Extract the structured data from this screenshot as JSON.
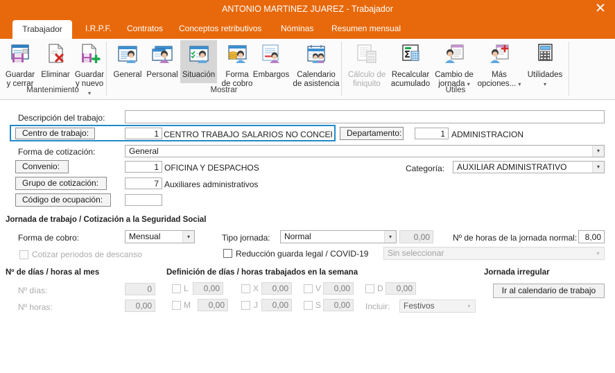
{
  "window": {
    "title": "ANTONIO MARTINEZ JUAREZ - Trabajador",
    "close_label": "✕",
    "accent_color": "#E8690B",
    "focus_color": "#2189C9"
  },
  "tabs": [
    {
      "label": "Trabajador",
      "active": true
    },
    {
      "label": "I.R.P.F.",
      "active": false
    },
    {
      "label": "Contratos",
      "active": false
    },
    {
      "label": "Conceptos retributivos",
      "active": false
    },
    {
      "label": "Nóminas",
      "active": false
    },
    {
      "label": "Resumen mensual",
      "active": false
    }
  ],
  "ribbon": {
    "groups": [
      {
        "label": "Mantenimiento"
      },
      {
        "label": "Mostrar"
      },
      {
        "label": "Útiles"
      }
    ],
    "buttons": [
      {
        "line1": "Guardar",
        "line2": "y cerrar",
        "icon": "save-close-icon",
        "state": "normal",
        "caret": false
      },
      {
        "line1": "Eliminar",
        "line2": "",
        "icon": "delete-icon",
        "state": "normal",
        "caret": false
      },
      {
        "line1": "Guardar",
        "line2": "y nuevo",
        "icon": "save-new-icon",
        "state": "normal",
        "caret": true
      },
      {
        "line1": "General",
        "line2": "",
        "icon": "general-icon",
        "state": "normal",
        "caret": false
      },
      {
        "line1": "Personal",
        "line2": "",
        "icon": "personal-icon",
        "state": "normal",
        "caret": false
      },
      {
        "line1": "Situación",
        "line2": "",
        "icon": "situacion-icon",
        "state": "selected",
        "caret": false
      },
      {
        "line1": "Forma",
        "line2": "de cobro",
        "icon": "forma-cobro-icon",
        "state": "normal",
        "caret": false
      },
      {
        "line1": "Embargos",
        "line2": "",
        "icon": "embargos-icon",
        "state": "normal",
        "caret": false
      },
      {
        "line1": "Calendario",
        "line2": "de asistencia",
        "icon": "calendario-asistencia-icon",
        "state": "normal",
        "caret": false
      },
      {
        "line1": "Cálculo de",
        "line2": "finiquito",
        "icon": "calculo-finiquito-icon",
        "state": "disabled",
        "caret": false
      },
      {
        "line1": "Recalcular",
        "line2": "acumulado",
        "icon": "recalcular-acumulado-icon",
        "state": "normal",
        "caret": false
      },
      {
        "line1": "Cambio de",
        "line2": "jornada",
        "icon": "cambio-jornada-icon",
        "state": "normal",
        "caret": true
      },
      {
        "line1": "Más",
        "line2": "opciones...",
        "icon": "mas-opciones-icon",
        "state": "normal",
        "caret": true
      },
      {
        "line1": "Utilidades",
        "line2": "",
        "icon": "utilidades-icon",
        "state": "normal",
        "caret": true
      }
    ]
  },
  "form": {
    "descripcion_trabajo": {
      "label": "Descripción del trabajo:",
      "value": ""
    },
    "centro_trabajo": {
      "label": "Centro de trabajo:",
      "code": "1",
      "name": "CENTRO TRABAJO SALARIOS NO CONCERTADO",
      "focused": true
    },
    "departamento": {
      "label": "Departamento:",
      "code": "1",
      "name": "ADMINISTRACION"
    },
    "forma_cotizacion": {
      "label": "Forma de cotización:",
      "value": "General"
    },
    "convenio": {
      "label": "Convenio:",
      "code": "1",
      "name": "OFICINA Y DESPACHOS"
    },
    "categoria": {
      "label": "Categoría:",
      "value": "AUXILIAR ADMINISTRATIVO"
    },
    "grupo_cotizacion": {
      "label": "Grupo de cotización:",
      "code": "7",
      "name": "Auxiliares administrativos"
    },
    "codigo_ocupacion": {
      "label": "Código de ocupación:",
      "code": ""
    }
  },
  "jornada": {
    "section_title": "Jornada de trabajo / Cotización a la Seguridad Social",
    "forma_cobro": {
      "label": "Forma de cobro:",
      "value": "Mensual"
    },
    "cotizar_descanso": {
      "label": "Cotizar periodos de descanso",
      "checked": false,
      "disabled": true
    },
    "tipo_jornada": {
      "label": "Tipo jornada:",
      "value": "Normal",
      "pct": "0,00"
    },
    "horas_normal": {
      "label": "Nº de horas de la jornada normal:",
      "value": "8,00"
    },
    "reduccion": {
      "label": "Reducción guarda legal / COVID-19",
      "checked": false,
      "select_value": "Sin seleccionar"
    }
  },
  "mes": {
    "title": "Nº de días / horas al mes",
    "dias": {
      "label": "Nº días:",
      "value": "0"
    },
    "horas": {
      "label": "Nº horas:",
      "value": "0,00"
    }
  },
  "semana": {
    "title": "Definición de días / horas trabajados en la semana",
    "days": [
      {
        "key": "L",
        "value": "0,00",
        "checked": false
      },
      {
        "key": "M",
        "value": "0,00",
        "checked": false
      },
      {
        "key": "X",
        "value": "0,00",
        "checked": false
      },
      {
        "key": "J",
        "value": "0,00",
        "checked": false
      },
      {
        "key": "V",
        "value": "0,00",
        "checked": false
      },
      {
        "key": "S",
        "value": "0,00",
        "checked": false
      },
      {
        "key": "D",
        "value": "0,00",
        "checked": false
      }
    ],
    "incluir": {
      "label": "Incluir:",
      "value": "Festivos"
    }
  },
  "irregular": {
    "title": "Jornada irregular",
    "button_label": "Ir al calendario de trabajo"
  }
}
